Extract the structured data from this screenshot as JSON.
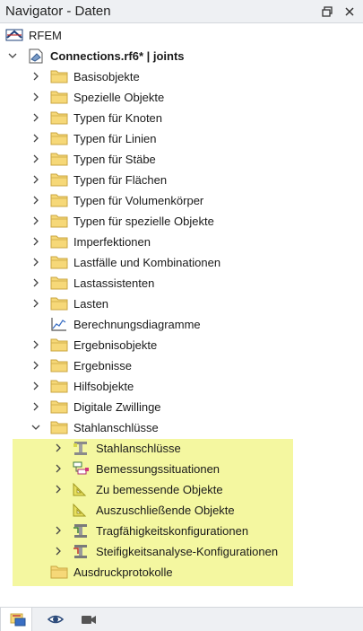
{
  "window": {
    "title": "Navigator - Daten",
    "pin_icon": "restore-icon",
    "close_icon": "close-icon"
  },
  "tree": {
    "root": {
      "label": "RFEM",
      "icon": "rfem-logo-icon"
    },
    "model": {
      "label": "Connections.rf6* | joints",
      "icon": "model-file-icon",
      "expanded": true
    },
    "items": [
      {
        "label": "Basisobjekte",
        "icon": "folder-icon",
        "expandable": true
      },
      {
        "label": "Spezielle Objekte",
        "icon": "folder-icon",
        "expandable": true
      },
      {
        "label": "Typen für Knoten",
        "icon": "folder-icon",
        "expandable": true
      },
      {
        "label": "Typen für Linien",
        "icon": "folder-icon",
        "expandable": true
      },
      {
        "label": "Typen für Stäbe",
        "icon": "folder-icon",
        "expandable": true
      },
      {
        "label": "Typen für Flächen",
        "icon": "folder-icon",
        "expandable": true
      },
      {
        "label": "Typen für Volumenkörper",
        "icon": "folder-icon",
        "expandable": true
      },
      {
        "label": "Typen für spezielle Objekte",
        "icon": "folder-icon",
        "expandable": true
      },
      {
        "label": "Imperfektionen",
        "icon": "folder-icon",
        "expandable": true
      },
      {
        "label": "Lastfälle und Kombinationen",
        "icon": "folder-icon",
        "expandable": true
      },
      {
        "label": "Lastassistenten",
        "icon": "folder-icon",
        "expandable": true
      },
      {
        "label": "Lasten",
        "icon": "folder-icon",
        "expandable": true
      },
      {
        "label": "Berechnungsdiagramme",
        "icon": "chart-icon",
        "expandable": false
      },
      {
        "label": "Ergebnisobjekte",
        "icon": "folder-icon",
        "expandable": true
      },
      {
        "label": "Ergebnisse",
        "icon": "folder-icon",
        "expandable": true
      },
      {
        "label": "Hilfsobjekte",
        "icon": "folder-icon",
        "expandable": true
      },
      {
        "label": "Digitale Zwillinge",
        "icon": "folder-icon",
        "expandable": true
      },
      {
        "label": "Stahlanschlüsse",
        "icon": "folder-icon",
        "expandable": true,
        "expanded": true,
        "highlighted": true
      }
    ],
    "steel_children": [
      {
        "label": "Stahlanschlüsse",
        "icon": "steel-connection-icon",
        "expandable": true
      },
      {
        "label": "Bemessungssituationen",
        "icon": "design-situation-icon",
        "expandable": true
      },
      {
        "label": "Zu bemessende Objekte",
        "icon": "objects-to-design-icon",
        "expandable": true
      },
      {
        "label": "Auszuschließende Objekte",
        "icon": "objects-to-exclude-icon",
        "expandable": false
      },
      {
        "label": "Tragfähigkeitskonfigurationen",
        "icon": "uls-configuration-icon",
        "expandable": true
      },
      {
        "label": "Steifigkeitsanalyse-Konfigurationen",
        "icon": "stiffness-configuration-icon",
        "expandable": true
      }
    ],
    "last": {
      "label": "Ausdruckprotokolle",
      "icon": "folder-icon",
      "expandable": false
    }
  },
  "bottom_tabs": [
    {
      "name": "data-tab",
      "icon": "data-navigator-icon",
      "active": true
    },
    {
      "name": "display-tab",
      "icon": "eye-icon",
      "active": false
    },
    {
      "name": "views-tab",
      "icon": "camera-icon",
      "active": false
    }
  ],
  "colors": {
    "highlight": "#f4f7a0",
    "folder": "#f6d878",
    "folder_border": "#c9a640"
  }
}
